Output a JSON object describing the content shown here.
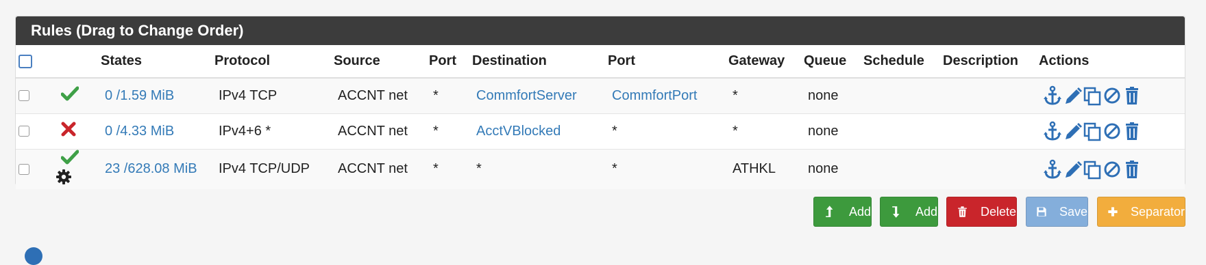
{
  "panel": {
    "title": "Rules (Drag to Change Order)"
  },
  "columns": {
    "states": "States",
    "protocol": "Protocol",
    "source": "Source",
    "port": "Port",
    "destination": "Destination",
    "dest_port": "Port",
    "gateway": "Gateway",
    "queue": "Queue",
    "schedule": "Schedule",
    "description": "Description",
    "actions": "Actions"
  },
  "rows": [
    {
      "status": "pass",
      "status_icon": "check-icon",
      "advanced": false,
      "states": "0 /1.59 MiB",
      "protocol": "IPv4 TCP",
      "source": "ACCNT net",
      "port": "*",
      "destination": "CommfortServer",
      "dest_port": "CommfortPort",
      "gateway": "*",
      "queue": "none",
      "schedule": "",
      "description": ""
    },
    {
      "status": "block",
      "status_icon": "times-icon",
      "advanced": false,
      "states": "0 /4.33 MiB",
      "protocol": "IPv4+6 *",
      "source": "ACCNT net",
      "port": "*",
      "destination": "AcctVBlocked",
      "dest_port": "*",
      "gateway": "*",
      "queue": "none",
      "schedule": "",
      "description": ""
    },
    {
      "status": "pass",
      "status_icon": "check-icon",
      "advanced": true,
      "states": "23 /628.08 MiB",
      "protocol": "IPv4 TCP/UDP",
      "source": "ACCNT net",
      "port": "*",
      "destination": "*",
      "dest_port": "*",
      "gateway": "ATHKL",
      "queue": "none",
      "schedule": "",
      "description": ""
    }
  ],
  "buttons": {
    "add_top": "Add",
    "add_bottom": "Add",
    "delete": "Delete",
    "save": "Save",
    "separator": "Separator"
  },
  "colors": {
    "header_bg": "#3c3c3c",
    "link": "#337ab7",
    "pass": "#3fa047",
    "block": "#c9252b",
    "action_icon": "#2e6fb5"
  }
}
